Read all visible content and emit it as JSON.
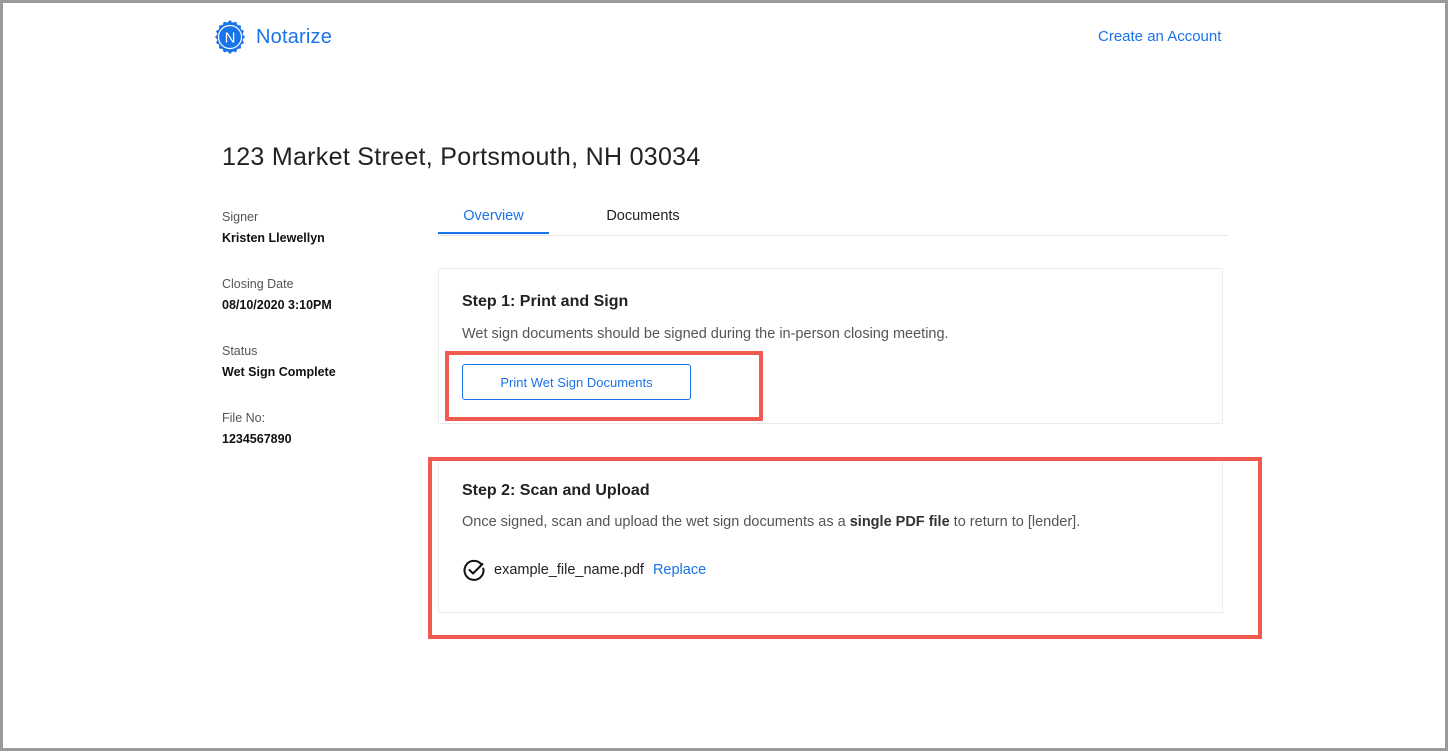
{
  "header": {
    "logo_text": "Notarize",
    "logo_letter": "N",
    "create_account": "Create an Account"
  },
  "page": {
    "title": "123 Market Street, Portsmouth, NH 03034"
  },
  "meta": [
    {
      "label": "Signer",
      "value": "Kristen Llewellyn"
    },
    {
      "label": "Closing Date",
      "value": "08/10/2020 3:10PM"
    },
    {
      "label": "Status",
      "value": "Wet Sign Complete"
    },
    {
      "label": "File No:",
      "value": "1234567890"
    }
  ],
  "tabs": [
    {
      "label": "Overview",
      "active": true
    },
    {
      "label": "Documents",
      "active": false
    }
  ],
  "step1": {
    "title": "Step 1: Print and Sign",
    "description": "Wet sign documents should be signed during the in-person closing meeting.",
    "button_label": "Print Wet Sign Documents"
  },
  "step2": {
    "title": "Step 2: Scan and Upload",
    "description_pre": "Once signed, scan and upload the wet sign documents as a ",
    "description_bold": "single PDF file",
    "description_post": " to return to [lender].",
    "file_name": "example_file_name.pdf",
    "replace_label": "Replace"
  },
  "colors": {
    "brand": "#1a73e8",
    "highlight": "#f05a4f",
    "text": "#222222",
    "muted": "#555555"
  },
  "icons": {
    "logo": "notary-seal-icon",
    "file_status": "check-circle-icon"
  }
}
